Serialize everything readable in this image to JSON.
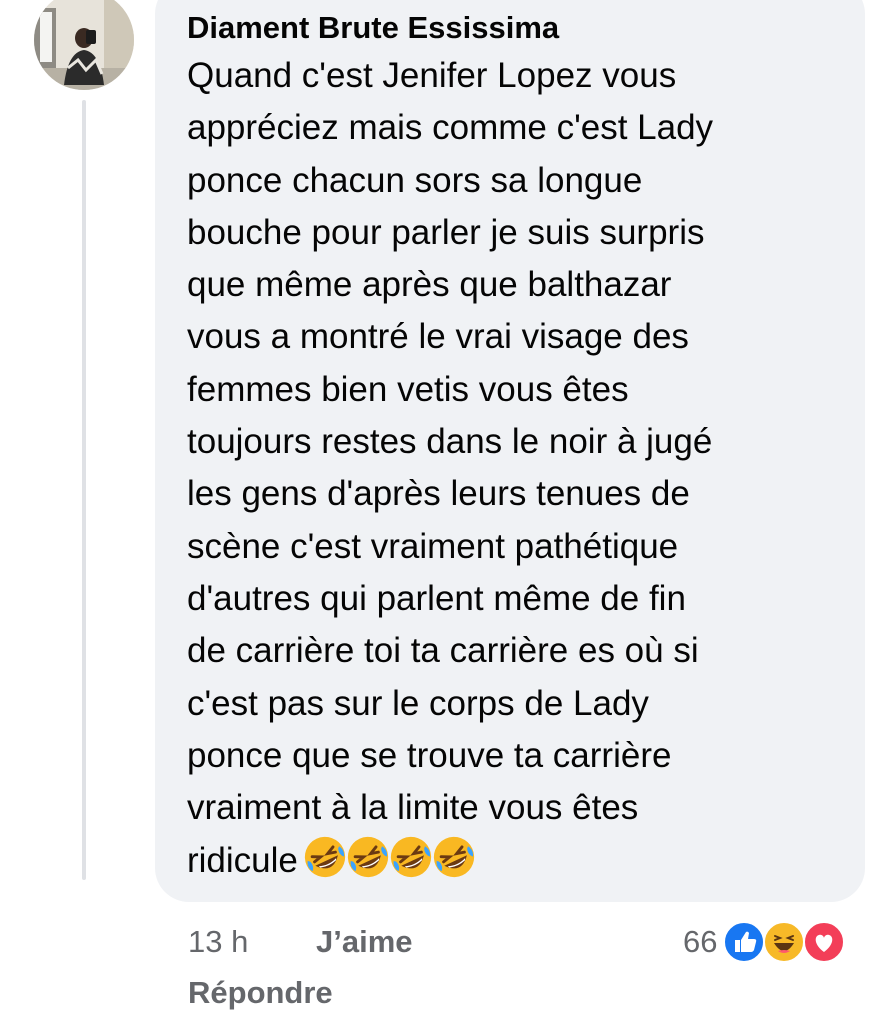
{
  "comment": {
    "author": "Diament Brute Essissima",
    "text_lines": [
      "Quand c'est Jenifer Lopez vous",
      "appréciez mais comme c'est Lady",
      "ponce chacun sors sa longue",
      "bouche pour parler je suis surpris",
      "que même après que balthazar",
      "vous a montré le vrai visage des",
      "femmes bien vetis vous êtes",
      "toujours restes dans le noir à jugé",
      "les gens d'après leurs tenues de",
      "scène c'est vraiment pathétique",
      "d'autres qui parlent même de fin",
      "de carrière toi ta carrière es où si",
      "c'est pas sur le corps de Lady",
      "ponce que se trouve ta carrière",
      "vraiment à la limite vous êtes",
      "ridicule"
    ],
    "trailing_emoji": [
      "rolling-on-floor-laughing",
      "rolling-on-floor-laughing",
      "rolling-on-floor-laughing",
      "rolling-on-floor-laughing"
    ]
  },
  "meta": {
    "time": "13 h",
    "like_label": "J’aime",
    "reply_label": "Répondre"
  },
  "reactions": {
    "count": "66",
    "types": [
      "like",
      "haha",
      "love"
    ],
    "colors": {
      "like": "#1877f2",
      "haha": "#f7b928",
      "love": "#f33e58"
    }
  },
  "colors": {
    "bubble": "#f0f2f5",
    "text": "#050505",
    "meta": "#65676b",
    "thread_line": "#dfe1e5"
  }
}
